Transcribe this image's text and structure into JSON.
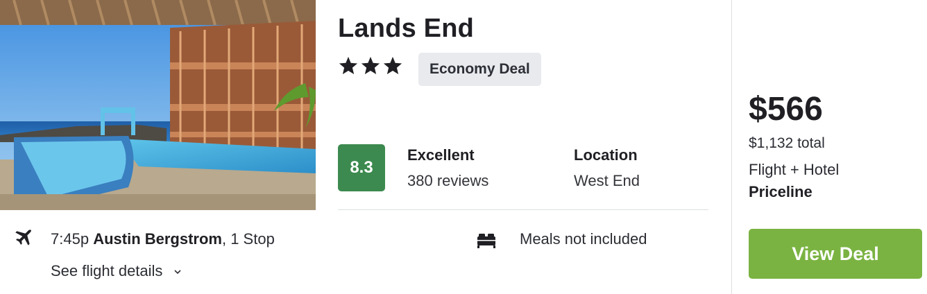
{
  "hotel": {
    "name": "Lands End",
    "star_rating": 3,
    "deal_badge": "Economy Deal",
    "photo_icon": "hotel-photo"
  },
  "rating": {
    "score": "8.3",
    "label": "Excellent",
    "reviews": "380 reviews",
    "score_color": "#3c8a4f"
  },
  "location": {
    "title": "Location",
    "area": "West End"
  },
  "flight": {
    "icon": "plane-icon",
    "time": "7:45p",
    "airport": "Austin Bergstrom",
    "stops": ", 1 Stop",
    "details_link": "See flight details"
  },
  "meals": {
    "icon": "bed-icon",
    "text": "Meals not included"
  },
  "pricing": {
    "price": "$566",
    "total": "$1,132 total",
    "package": "Flight + Hotel",
    "provider": "Priceline",
    "cta": "View Deal",
    "cta_color": "#7ab342"
  }
}
